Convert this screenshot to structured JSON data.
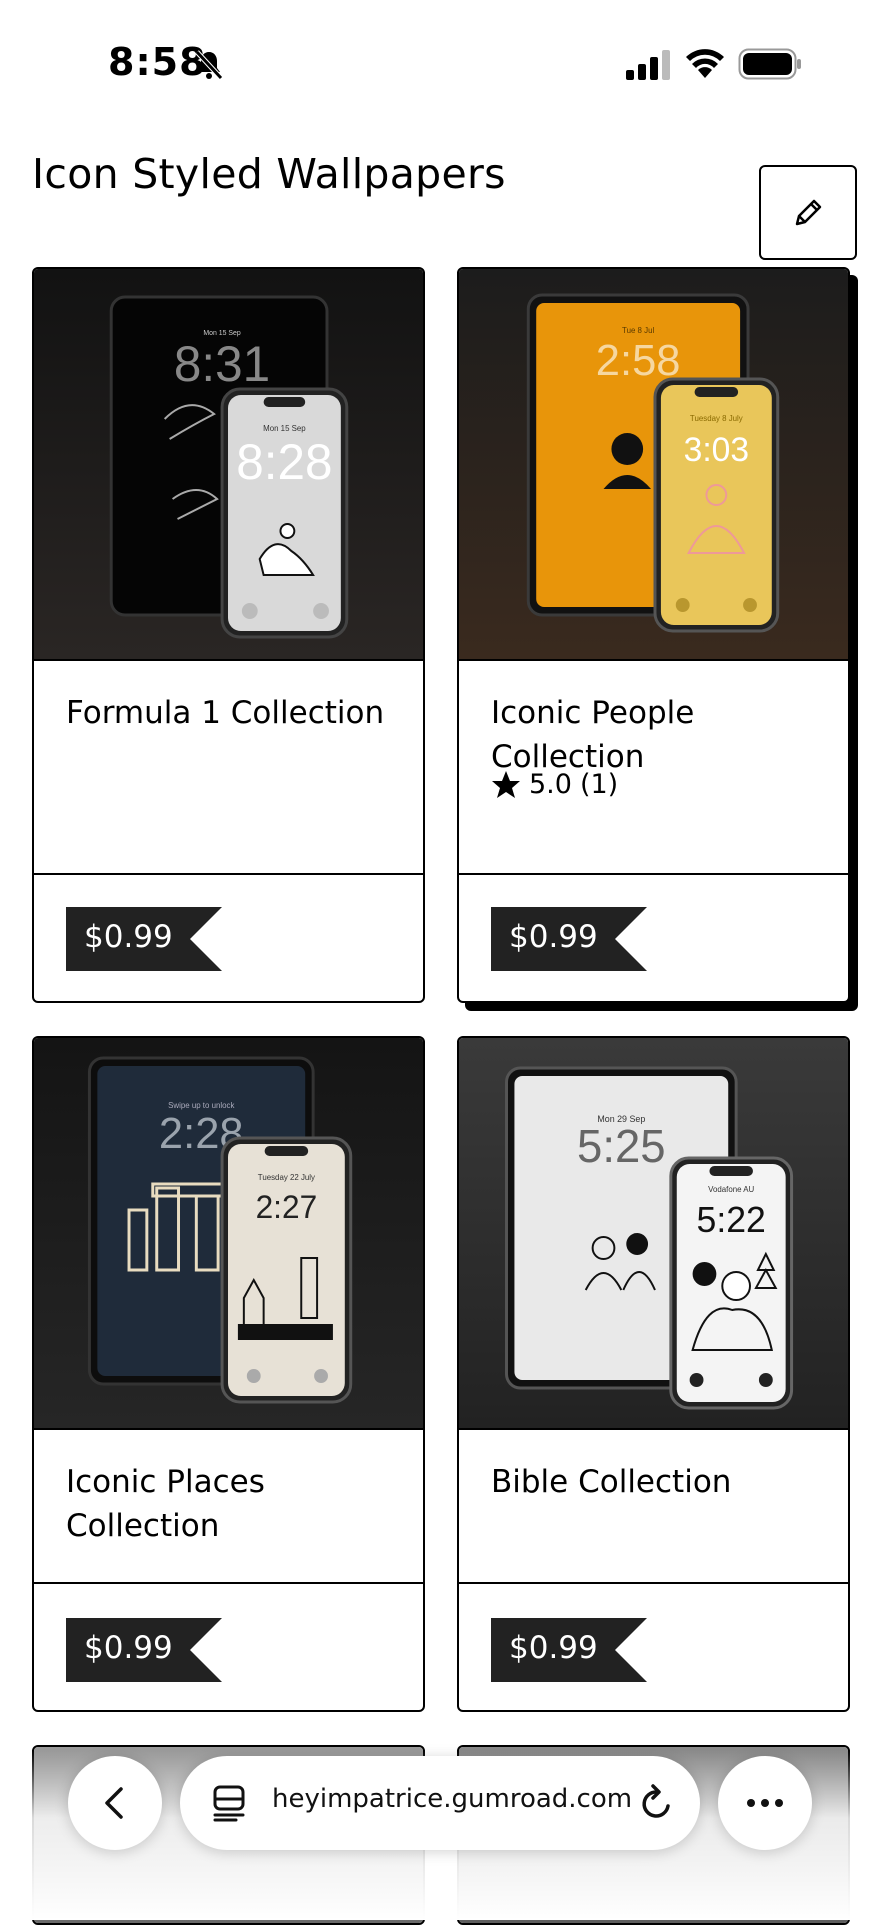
{
  "status_bar": {
    "time": "8:58"
  },
  "page": {
    "title": "Icon Styled Wallpapers"
  },
  "products": [
    {
      "name": "Formula 1 Collection",
      "price": "$0.99",
      "screens": {
        "big_clock": "8:31",
        "big_date": "Mon 15 Sep",
        "small_clock": "8:28",
        "small_date": "Mon 15 Sep"
      }
    },
    {
      "name": "Iconic People Collection",
      "price": "$0.99",
      "rating": "5.0",
      "rating_count": "(1)",
      "screens": {
        "big_clock": "2:58",
        "big_date": "Tue 8 Jul",
        "small_clock": "3:03",
        "small_date": "Tuesday 8 July"
      }
    },
    {
      "name": "Iconic Places Collection",
      "price": "$0.99",
      "screens": {
        "big_clock": "2:28",
        "big_date": "Swipe up to unlock",
        "small_clock": "2:27",
        "small_date": "Tuesday 22 July"
      }
    },
    {
      "name": "Bible Collection",
      "price": "$0.99",
      "screens": {
        "big_clock": "5:25",
        "big_date": "Mon 29 Sep",
        "small_clock": "5:22",
        "small_date": "Vodafone AU"
      }
    }
  ],
  "browser": {
    "url": "heyimpatrice.gumroad.com"
  },
  "icons": {
    "edit": "pencil-icon",
    "back": "chevron-left-icon",
    "tabs": "tabs-icon",
    "reload": "reload-icon",
    "more": "more-icon",
    "star": "star-icon"
  },
  "colors": {
    "ink": "#000000",
    "tag": "#222222",
    "people_bg": "#e8950a",
    "people_small": "#e9c65a"
  }
}
